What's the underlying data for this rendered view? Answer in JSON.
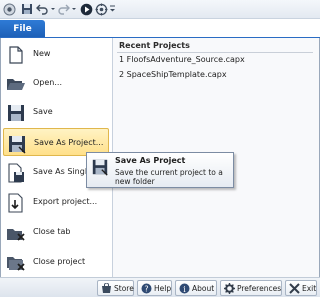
{
  "file_tab": "File",
  "commands": [
    {
      "label": "New",
      "icon": "new-document-icon"
    },
    {
      "label": "Open...",
      "icon": "folder-open-icon"
    },
    {
      "label": "Save",
      "icon": "floppy-save-icon"
    },
    {
      "label": "Save As Project...",
      "icon": "floppy-save-as-icon"
    },
    {
      "label": "Save As Single File...",
      "icon": "save-single-file-icon"
    },
    {
      "label": "Export project...",
      "icon": "export-icon"
    },
    {
      "label": "Close tab",
      "icon": "close-tab-icon"
    },
    {
      "label": "Close project",
      "icon": "close-project-icon"
    }
  ],
  "recent": {
    "heading": "Recent Projects",
    "items": [
      "1 FloofsAdventure_Source.capx",
      "2 SpaceShipTemplate.capx"
    ]
  },
  "tooltip": {
    "title": "Save As Project",
    "description": "Save the current project to a new folder"
  },
  "bottom_buttons": [
    {
      "label": "Store",
      "icon": "store-icon"
    },
    {
      "label": "Help",
      "icon": "help-icon"
    },
    {
      "label": "About",
      "icon": "info-icon"
    },
    {
      "label": "Preferences",
      "icon": "gear-icon"
    },
    {
      "label": "Exit",
      "icon": "exit-icon"
    }
  ],
  "colors": {
    "file_tab": "#2f7bd6",
    "highlight": "#ffe08a",
    "highlight_border": "#e0b74c"
  }
}
